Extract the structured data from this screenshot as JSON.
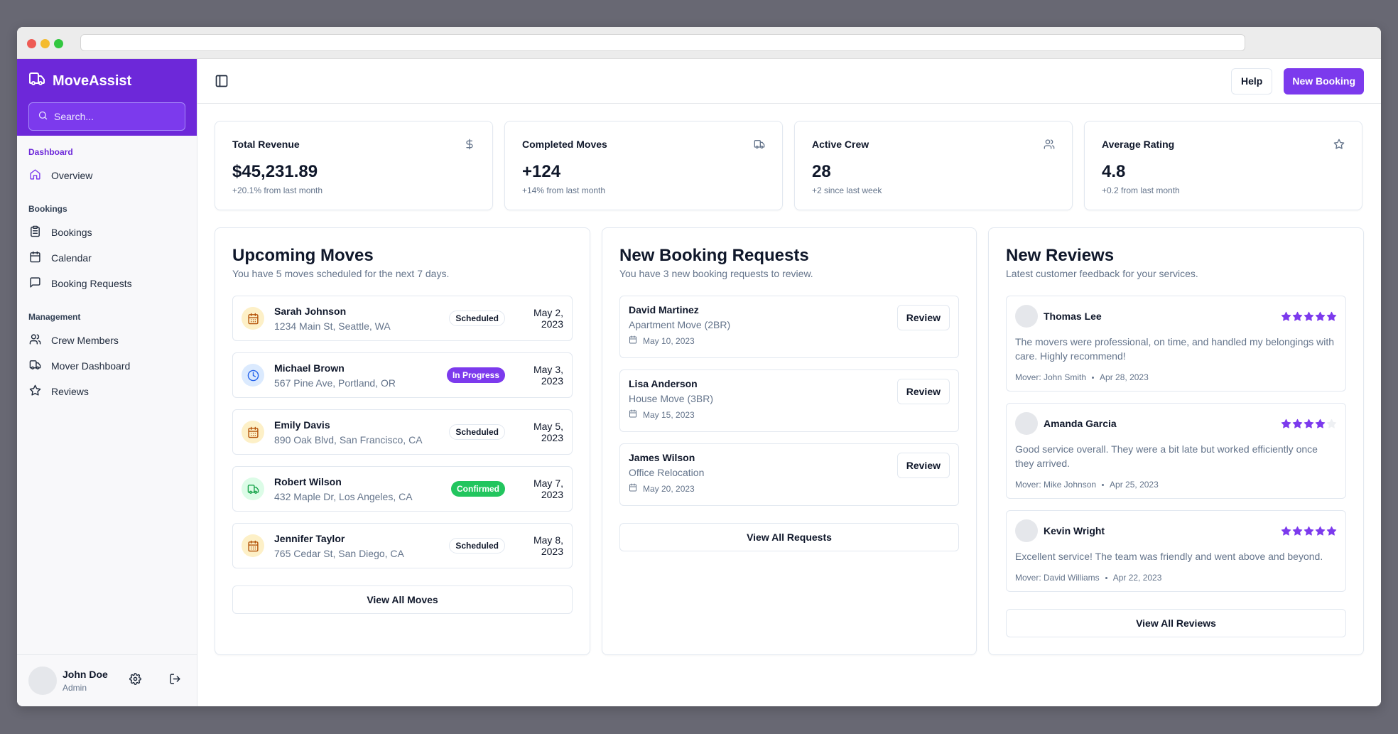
{
  "brand": {
    "name": "MoveAssist"
  },
  "search": {
    "placeholder": "Search..."
  },
  "sidebar": {
    "groups": [
      {
        "label": "Dashboard",
        "items": [
          {
            "label": "Overview",
            "icon": "home-icon"
          }
        ]
      },
      {
        "label": "Bookings",
        "items": [
          {
            "label": "Bookings",
            "icon": "clipboard-icon"
          },
          {
            "label": "Calendar",
            "icon": "calendar-icon"
          },
          {
            "label": "Booking Requests",
            "icon": "message-square-icon"
          }
        ]
      },
      {
        "label": "Management",
        "items": [
          {
            "label": "Crew Members",
            "icon": "users-icon"
          },
          {
            "label": "Mover Dashboard",
            "icon": "truck-icon"
          },
          {
            "label": "Reviews",
            "icon": "star-icon"
          }
        ]
      }
    ]
  },
  "user": {
    "name": "John Doe",
    "role": "Admin"
  },
  "topbar": {
    "help_label": "Help",
    "new_booking_label": "New Booking"
  },
  "stats": [
    {
      "title": "Total Revenue",
      "value": "$45,231.89",
      "sub": "+20.1% from last month",
      "icon": "dollar-icon"
    },
    {
      "title": "Completed Moves",
      "value": "+124",
      "sub": "+14% from last month",
      "icon": "truck-icon"
    },
    {
      "title": "Active Crew",
      "value": "28",
      "sub": "+2 since last week",
      "icon": "users-icon"
    },
    {
      "title": "Average Rating",
      "value": "4.8",
      "sub": "+0.2 from last month",
      "icon": "star-icon"
    }
  ],
  "upcoming": {
    "title": "Upcoming Moves",
    "desc": "You have 5 moves scheduled for the next 7 days.",
    "items": [
      {
        "name": "Sarah Johnson",
        "address": "1234 Main St, Seattle, WA",
        "status": "Scheduled",
        "date": "May 2, 2023",
        "icon": "calendar-icon"
      },
      {
        "name": "Michael Brown",
        "address": "567 Pine Ave, Portland, OR",
        "status": "In Progress",
        "date": "May 3, 2023",
        "icon": "clock-icon"
      },
      {
        "name": "Emily Davis",
        "address": "890 Oak Blvd, San Francisco, CA",
        "status": "Scheduled",
        "date": "May 5, 2023",
        "icon": "calendar-icon"
      },
      {
        "name": "Robert Wilson",
        "address": "432 Maple Dr, Los Angeles, CA",
        "status": "Confirmed",
        "date": "May 7, 2023",
        "icon": "truck-icon"
      },
      {
        "name": "Jennifer Taylor",
        "address": "765 Cedar St, San Diego, CA",
        "status": "Scheduled",
        "date": "May 8, 2023",
        "icon": "calendar-icon"
      }
    ],
    "button": "View All Moves"
  },
  "requests": {
    "title": "New Booking Requests",
    "desc": "You have 3 new booking requests to review.",
    "items": [
      {
        "name": "David Martinez",
        "type": "Apartment Move (2BR)",
        "date": "May 10, 2023",
        "action": "Review"
      },
      {
        "name": "Lisa Anderson",
        "type": "House Move (3BR)",
        "date": "May 15, 2023",
        "action": "Review"
      },
      {
        "name": "James Wilson",
        "type": "Office Relocation",
        "date": "May 20, 2023",
        "action": "Review"
      }
    ],
    "button": "View All Requests"
  },
  "reviews": {
    "title": "New Reviews",
    "desc": "Latest customer feedback for your services.",
    "items": [
      {
        "name": "Thomas Lee",
        "rating": 5,
        "text": "The movers were professional, on time, and handled my belongings with care. Highly recommend!",
        "mover": "Mover: John Smith",
        "date": "Apr 28, 2023"
      },
      {
        "name": "Amanda Garcia",
        "rating": 4,
        "text": "Good service overall. They were a bit late but worked efficiently once they arrived.",
        "mover": "Mover: Mike Johnson",
        "date": "Apr 25, 2023"
      },
      {
        "name": "Kevin Wright",
        "rating": 5,
        "text": "Excellent service! The team was friendly and went above and beyond.",
        "mover": "Mover: David Williams",
        "date": "Apr 22, 2023"
      }
    ],
    "button": "View All Reviews"
  },
  "colors": {
    "accent": "#7c3aed",
    "brand_band": "#6d28d9",
    "star": "#7c3aed",
    "confirmed": "#22c55e"
  }
}
